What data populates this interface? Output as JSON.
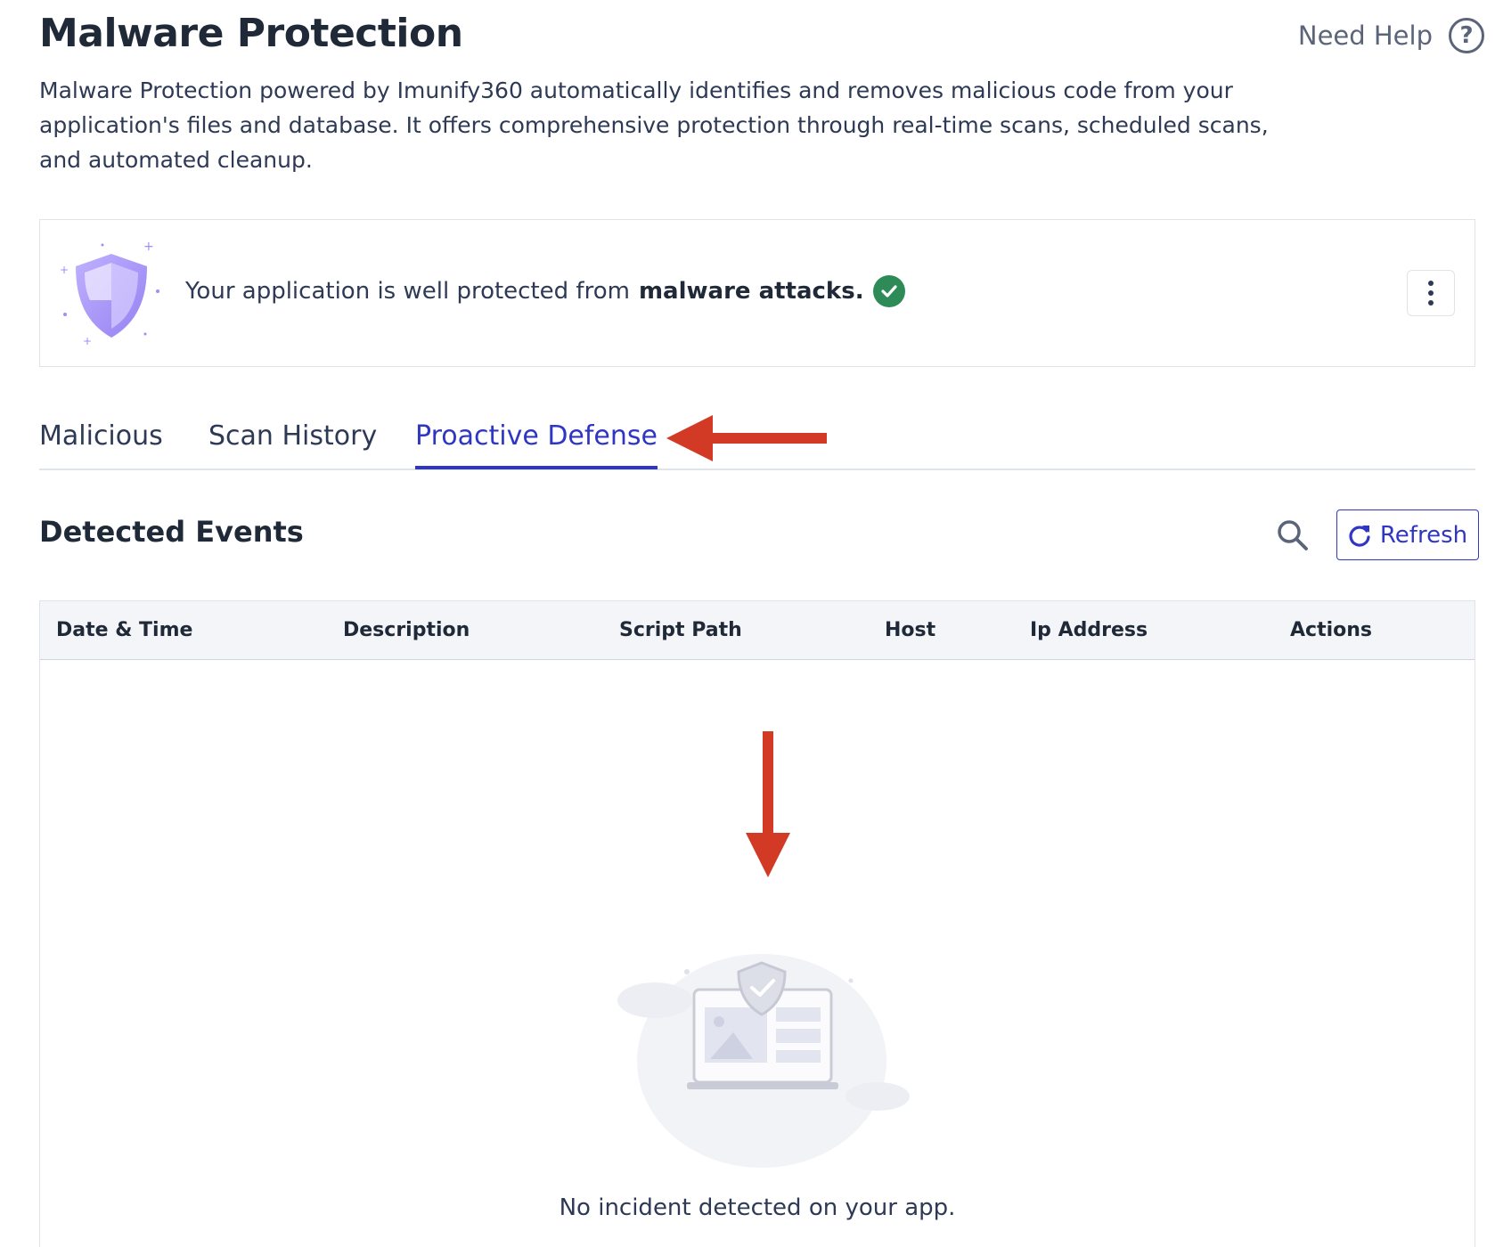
{
  "header": {
    "title": "Malware Protection",
    "help_label": "Need Help",
    "help_icon_glyph": "?"
  },
  "intro_text": "Malware Protection powered by Imunify360 automatically identifies and removes malicious code from your application's files and database. It offers comprehensive protection through real-time scans, scheduled scans, and automated cleanup.",
  "status": {
    "prefix": "Your application is well protected from",
    "emphasis": "malware attacks.",
    "icon": "check-circle-icon",
    "icon_color": "#2e8b57"
  },
  "tabs": [
    {
      "label": "Malicious",
      "active": false
    },
    {
      "label": "Scan History",
      "active": false
    },
    {
      "label": "Proactive Defense",
      "active": true
    }
  ],
  "events": {
    "title": "Detected Events",
    "refresh_label": "Refresh",
    "columns": [
      "Date & Time",
      "Description",
      "Script Path",
      "Host",
      "Ip Address",
      "Actions"
    ],
    "rows": [],
    "empty_message": "No incident detected on your app."
  },
  "colors": {
    "accent": "#2f36c4",
    "annotation_arrow": "#d23a26",
    "text": "#2e3a55"
  }
}
